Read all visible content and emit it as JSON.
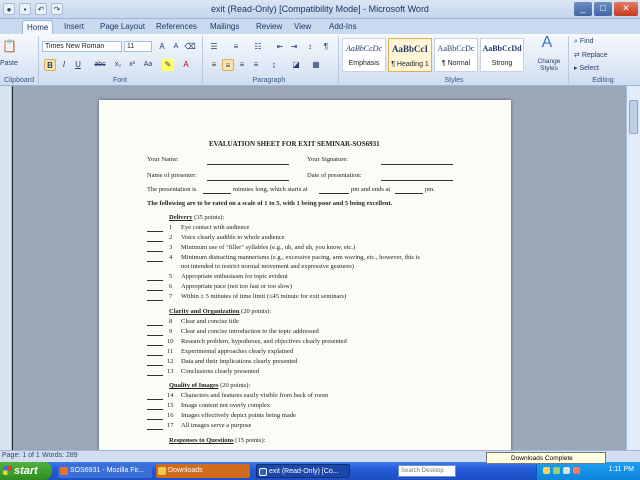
{
  "window": {
    "title": "exit (Read-Only) [Compatibility Mode] - Microsoft Word",
    "min_glyph": "_",
    "max_glyph": "□",
    "close_glyph": "✕"
  },
  "tabs": [
    "Home",
    "Insert",
    "Page Layout",
    "References",
    "Mailings",
    "Review",
    "View",
    "Add-Ins"
  ],
  "ribbon": {
    "font_name": "Times New Roman",
    "font_size": "11",
    "font_group_label": "Font",
    "paragraph_group_label": "Paragraph",
    "styles_group_label": "Styles",
    "editing_group_label": "Editing",
    "clipboard_group_label": "Clipboard",
    "paste_label": "Paste",
    "styles": [
      {
        "sample": "AaBbCcDc",
        "name": "Emphasis"
      },
      {
        "sample": "AaBbCcI",
        "name": "¶ Heading 1"
      },
      {
        "sample": "AaBbCcDc",
        "name": "¶ Normal"
      },
      {
        "sample": "AaBbCcDd",
        "name": "Strong"
      }
    ],
    "change_styles_label": "Change Styles",
    "find_label": "Find",
    "replace_label": "Replace",
    "select_label": "Select"
  },
  "document": {
    "title": "EVALUATION SHEET FOR EXIT SEMINAR-SOS6931",
    "your_name": "Your Name:",
    "your_signature": "Your Signature:",
    "presenter": "Name of presenter:",
    "date": "Date of presentation:",
    "length_line_a": "The presentation is",
    "length_line_b": "minutes long, which starts at",
    "length_line_c": "pm and ends at",
    "length_line_d": "pm.",
    "instructions": "The following are to be rated on a scale of 1 to 5, with 1 being poor and 5 being excellent.",
    "sections": [
      {
        "heading": "Delivery",
        "points": "(35 points):",
        "items": [
          {
            "n": "1",
            "text": "Eye contact with audience"
          },
          {
            "n": "2",
            "text": "Voice clearly audible to whole audience"
          },
          {
            "n": "3",
            "text": "Minimum use of \"filler\" syllables (e.g., uh, and uh, you know, etc.)"
          },
          {
            "n": "4",
            "text": "Minimum distracting mannerisms (e.g., excessive pacing, arm waving, etc., however, this is"
          },
          {
            "n": "",
            "text": "not intended to restrict normal movement and expressive gestures)"
          },
          {
            "n": "5",
            "text": "Appropriate enthusiasm for topic evident"
          },
          {
            "n": "6",
            "text": "Appropriate pace (not too fast or too slow)"
          },
          {
            "n": "7",
            "text": "Within ± 5 minutes of time limit (≤45 minute for exit seminars)"
          }
        ]
      },
      {
        "heading": "Clarity and Organization",
        "points": "(20 points):",
        "items": [
          {
            "n": "8",
            "text": "Clear and concise title"
          },
          {
            "n": "9",
            "text": "Clear and concise introduction to the topic addressed"
          },
          {
            "n": "10",
            "text": "Research problem, hypotheses, and objectives clearly presented"
          },
          {
            "n": "11",
            "text": "Experimental approaches clearly explained"
          },
          {
            "n": "12",
            "text": "Data and their implications clearly presented"
          },
          {
            "n": "13",
            "text": "Conclusions clearly presented"
          }
        ]
      },
      {
        "heading": "Quality of Images",
        "points": "(20 points):",
        "items": [
          {
            "n": "14",
            "text": "Characters and features easily visible from back of room"
          },
          {
            "n": "15",
            "text": "Image content not overly complex"
          },
          {
            "n": "16",
            "text": "Images effectively depict points being made"
          },
          {
            "n": "17",
            "text": "All images serve a purpose"
          }
        ]
      },
      {
        "heading": "Responses to Questions",
        "points": "(15 points):",
        "items": []
      }
    ]
  },
  "status": {
    "page": "Page: 1 of 1",
    "words": "Words: 289"
  },
  "taskbar": {
    "start_label": "start",
    "tasks": [
      {
        "label": "SOS6931 - Mozilla Fir...",
        "color": "#e8702a"
      },
      {
        "label": "Downloads",
        "color": "#f2c94c"
      },
      {
        "label": "exit (Read-Only) [Co...",
        "color": "#2f5fb6"
      }
    ],
    "search_placeholder": "Search Desktop",
    "clock": "1:11 PM",
    "tooltip": "Downloads Complete"
  },
  "colors": {
    "ribbon_accent": "#c9d9ef",
    "taskbar_blue": "#245ad8",
    "start_green": "#3a9a2b"
  }
}
